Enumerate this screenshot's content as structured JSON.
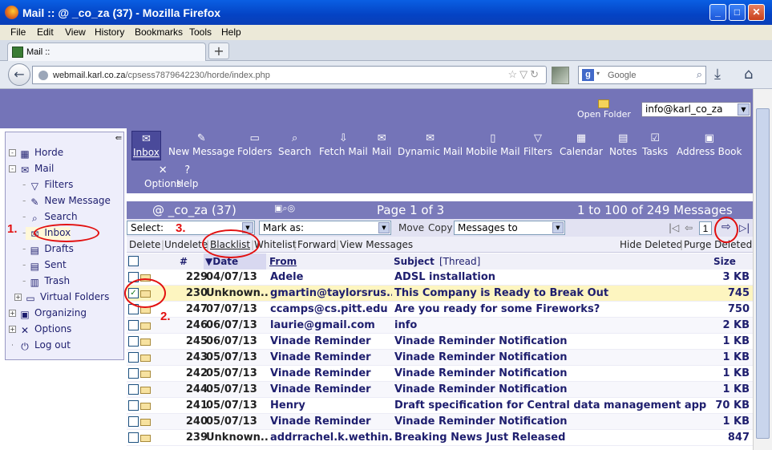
{
  "window": {
    "title": "Mail ::       @       _co_za (37) - Mozilla Firefox",
    "min": "_",
    "max": "□",
    "close": "✕"
  },
  "menu": [
    "File",
    "Edit",
    "View",
    "History",
    "Bookmarks",
    "Tools",
    "Help"
  ],
  "tab": {
    "label": "Mail ::",
    "new_tab": "+"
  },
  "nav": {
    "url_domain": "webmail.karl.co.za",
    "url": "webmail.karl.co.za/cpsess7879642230/horde/index.php",
    "search_placeholder": "Google",
    "search_engine": "g"
  },
  "header": {
    "open_folder": "Open Folder",
    "account": "info@karl_co_za"
  },
  "sidebar": [
    {
      "label": "Horde",
      "icon": "horde-icon",
      "level": 0,
      "expander": "-"
    },
    {
      "label": "Mail",
      "icon": "mail-icon",
      "level": 0,
      "expander": "-"
    },
    {
      "label": "Filters",
      "icon": "filter-icon",
      "level": 1
    },
    {
      "label": "New Message",
      "icon": "compose-icon",
      "level": 1
    },
    {
      "label": "Search",
      "icon": "search-icon",
      "level": 1
    },
    {
      "label": "Inbox",
      "icon": "inbox-icon",
      "level": 1,
      "selected": true
    },
    {
      "label": "Drafts",
      "icon": "drafts-icon",
      "level": 1
    },
    {
      "label": "Sent",
      "icon": "sent-icon",
      "level": 1
    },
    {
      "label": "Trash",
      "icon": "trash-icon",
      "level": 1
    },
    {
      "label": "Virtual Folders",
      "icon": "folder-icon",
      "level": 1,
      "expander": "+"
    },
    {
      "label": "Organizing",
      "icon": "organizing-icon",
      "level": 0,
      "expander": "+"
    },
    {
      "label": "Options",
      "icon": "options-icon",
      "level": 0,
      "expander": "+"
    },
    {
      "label": "Log out",
      "icon": "logout-icon",
      "level": 0
    }
  ],
  "toolbar": [
    {
      "label": "Inbox",
      "icon": "inbox-icon",
      "active": true
    },
    {
      "label": "New Message",
      "icon": "compose-icon"
    },
    {
      "label": "Folders",
      "icon": "folder-icon"
    },
    {
      "label": "Search",
      "icon": "search-icon"
    },
    {
      "label": "Fetch Mail",
      "icon": "fetch-icon"
    },
    {
      "label": "Mail",
      "icon": "mail-icon"
    },
    {
      "label": "Dynamic Mail",
      "icon": "dynamic-mail-icon"
    },
    {
      "label": "Mobile Mail",
      "icon": "mobile-icon"
    },
    {
      "label": "Filters",
      "icon": "filter-icon"
    },
    {
      "label": "Calendar",
      "icon": "calendar-icon"
    },
    {
      "label": "Notes",
      "icon": "notes-icon"
    },
    {
      "label": "Tasks",
      "icon": "tasks-icon"
    },
    {
      "label": "Address Book",
      "icon": "address-book-icon"
    },
    {
      "label": "Options",
      "icon": "options-icon"
    },
    {
      "label": "Help",
      "icon": "help-icon"
    }
  ],
  "mailbox": {
    "name": "@        _co_za (37)",
    "page": "Page 1 of 3",
    "range": "1 to 100 of 249 Messages"
  },
  "controls": {
    "select": "Select:",
    "mark_as": "Mark as:",
    "move": "Move",
    "copy": "Copy",
    "messages_to": "Messages to",
    "page_value": "1"
  },
  "actions": {
    "delete": "Delete",
    "undelete": "Undelete",
    "blacklist": "Blacklist",
    "whitelist": "Whitelist",
    "forward": "Forward",
    "view": "View Messages",
    "hide_deleted": "Hide Deleted",
    "purge_deleted": "Purge Deleted"
  },
  "columns": {
    "num": "#",
    "date": "▼Date",
    "from": "From",
    "subject": "Subject",
    "thread": "[Thread]",
    "size": "Size"
  },
  "messages": [
    {
      "num": "229",
      "date": "04/07/13",
      "from": "Adele",
      "subject": "ADSL installation",
      "size": "3 KB",
      "checked": false
    },
    {
      "num": "230",
      "date": "Unknown...",
      "from": "gmartin@taylorsrus...",
      "subject": "This Company is Ready to Break Out",
      "size": "745",
      "checked": true
    },
    {
      "num": "247",
      "date": "07/07/13",
      "from": "ccamps@cs.pitt.edu",
      "subject": "Are you ready for some Fireworks?",
      "size": "750",
      "checked": false
    },
    {
      "num": "246",
      "date": "06/07/13",
      "from": "laurie@gmail.com",
      "subject": "info",
      "size": "2 KB",
      "checked": false
    },
    {
      "num": "245",
      "date": "06/07/13",
      "from": "Vinade Reminder",
      "subject": "Vinade Reminder Notification",
      "size": "1 KB",
      "checked": false
    },
    {
      "num": "243",
      "date": "05/07/13",
      "from": "Vinade Reminder",
      "subject": "Vinade Reminder Notification",
      "size": "1 KB",
      "checked": false
    },
    {
      "num": "242",
      "date": "05/07/13",
      "from": "Vinade Reminder",
      "subject": "Vinade Reminder Notification",
      "size": "1 KB",
      "checked": false
    },
    {
      "num": "244",
      "date": "05/07/13",
      "from": "Vinade Reminder",
      "subject": "Vinade Reminder Notification",
      "size": "1 KB",
      "checked": false
    },
    {
      "num": "241",
      "date": "05/07/13",
      "from": "Henry",
      "subject": "Draft specification for Central data management app",
      "size": "70 KB",
      "checked": false
    },
    {
      "num": "240",
      "date": "05/07/13",
      "from": "Vinade Reminder",
      "subject": "Vinade Reminder Notification",
      "size": "1 KB",
      "checked": false
    },
    {
      "num": "239",
      "date": "Unknown...",
      "from": "addrrachel.k.wethin...",
      "subject": "Breaking News Just Released",
      "size": "847",
      "checked": false
    }
  ],
  "annotations": {
    "step1": "1.",
    "step2": "2.",
    "step3": "3."
  },
  "colors": {
    "horde_purple": "#7474b8",
    "highlight": "#fdf5c0",
    "annotation_red": "#e21010"
  }
}
